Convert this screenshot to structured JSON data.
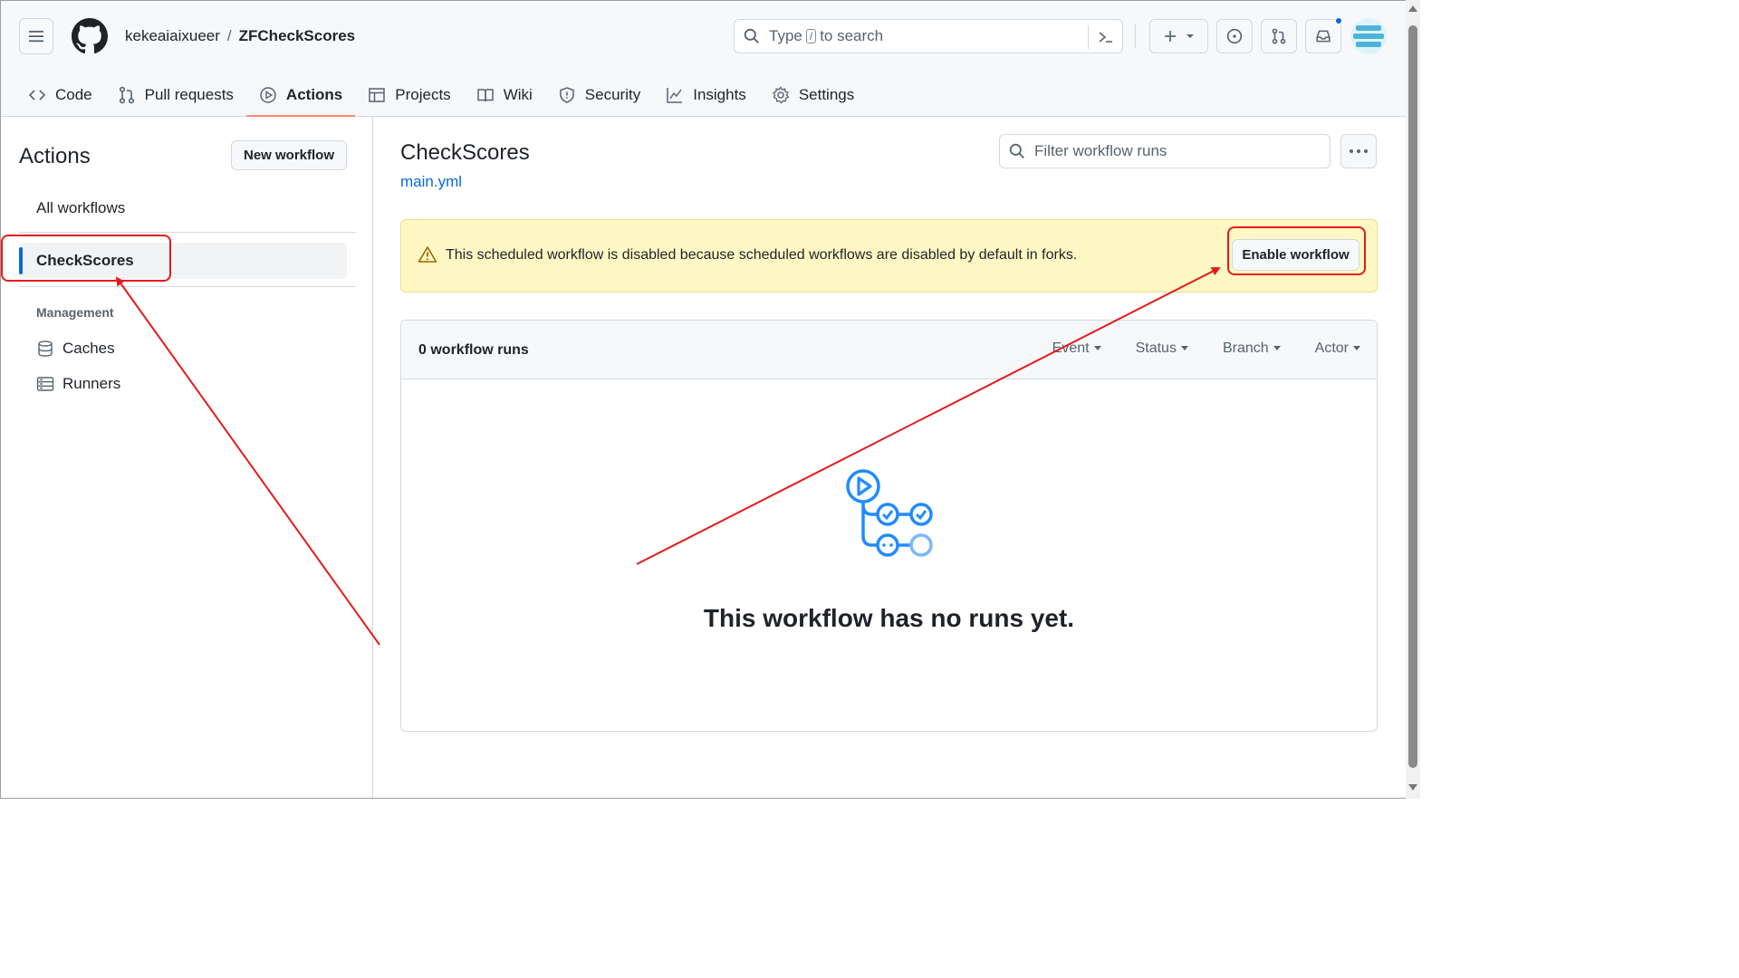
{
  "header": {
    "repo_owner": "kekeaiaixueer",
    "repo_separator": "/",
    "repo_name": "ZFCheckScores",
    "search": {
      "pre": "Type",
      "key": "/",
      "post": "to search"
    }
  },
  "tabs": [
    {
      "label": "Code",
      "icon": "code-icon"
    },
    {
      "label": "Pull requests",
      "icon": "pull-request-icon"
    },
    {
      "label": "Actions",
      "icon": "play-icon",
      "active": true
    },
    {
      "label": "Projects",
      "icon": "table-icon"
    },
    {
      "label": "Wiki",
      "icon": "book-icon"
    },
    {
      "label": "Security",
      "icon": "shield-icon"
    },
    {
      "label": "Insights",
      "icon": "graph-icon"
    },
    {
      "label": "Settings",
      "icon": "gear-icon"
    }
  ],
  "sidebar": {
    "title": "Actions",
    "new_workflow": "New workflow",
    "all_workflows": "All workflows",
    "active_workflow": "CheckScores",
    "management_heading": "Management",
    "caches": "Caches",
    "runners": "Runners"
  },
  "main": {
    "title": "CheckScores",
    "file": "main.yml",
    "filter_placeholder": "Filter workflow runs",
    "flash_text": "This scheduled workflow is disabled because scheduled workflows are disabled by default in forks.",
    "enable_button": "Enable workflow",
    "runs_count": "0 workflow runs",
    "filters": [
      "Event",
      "Status",
      "Branch",
      "Actor"
    ],
    "empty_text": "This workflow has no runs yet."
  },
  "colors": {
    "accent": "#0969da",
    "tab_underline": "#fd8c73",
    "flash_bg": "#fff8c5",
    "annotation": "#e31b1b"
  }
}
